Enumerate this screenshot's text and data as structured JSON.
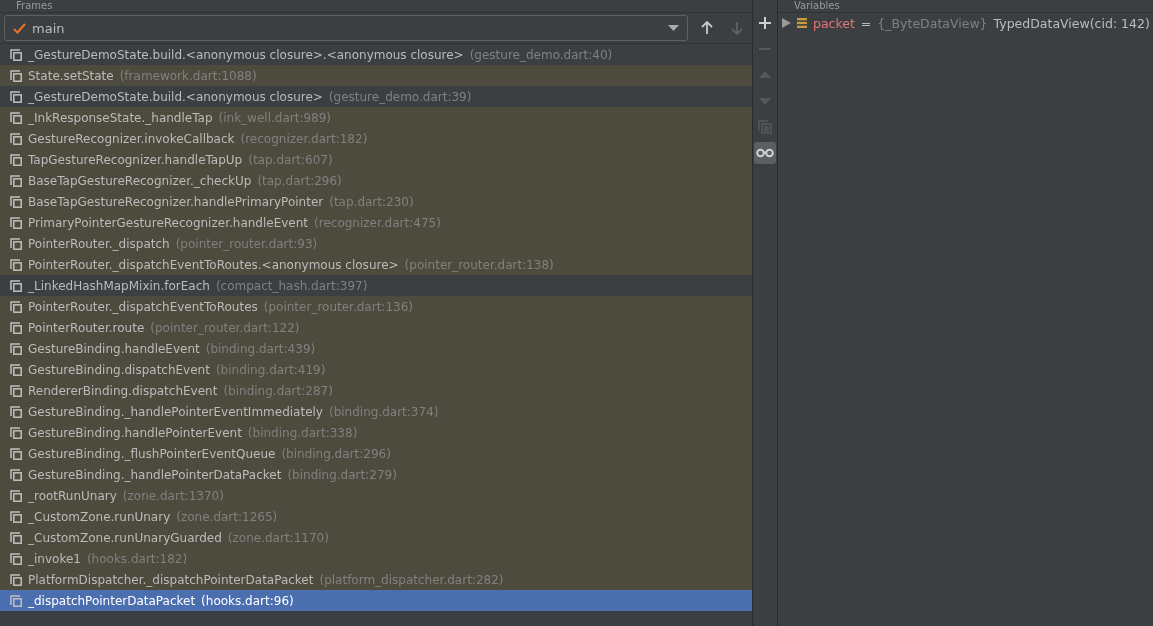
{
  "frames_panel": {
    "title": "Frames",
    "thread": {
      "value": "main"
    },
    "nav": [
      {
        "kind": "up",
        "disabled": false
      },
      {
        "kind": "down",
        "disabled": true
      }
    ],
    "rows": [
      {
        "method": "_GestureDemoState.build.<anonymous closure>.<anonymous closure>",
        "location": "(gesture_demo.dart:40)",
        "library": false,
        "selected": false
      },
      {
        "method": "State.setState",
        "location": "(framework.dart:1088)",
        "library": true,
        "selected": false
      },
      {
        "method": "_GestureDemoState.build.<anonymous closure>",
        "location": "(gesture_demo.dart:39)",
        "library": false,
        "selected": false
      },
      {
        "method": "_InkResponseState._handleTap",
        "location": "(ink_well.dart:989)",
        "library": true,
        "selected": false
      },
      {
        "method": "GestureRecognizer.invokeCallback",
        "location": "(recognizer.dart:182)",
        "library": true,
        "selected": false
      },
      {
        "method": "TapGestureRecognizer.handleTapUp",
        "location": "(tap.dart:607)",
        "library": true,
        "selected": false
      },
      {
        "method": "BaseTapGestureRecognizer._checkUp",
        "location": "(tap.dart:296)",
        "library": true,
        "selected": false
      },
      {
        "method": "BaseTapGestureRecognizer.handlePrimaryPointer",
        "location": "(tap.dart:230)",
        "library": true,
        "selected": false
      },
      {
        "method": "PrimaryPointerGestureRecognizer.handleEvent",
        "location": "(recognizer.dart:475)",
        "library": true,
        "selected": false
      },
      {
        "method": "PointerRouter._dispatch",
        "location": "(pointer_router.dart:93)",
        "library": true,
        "selected": false
      },
      {
        "method": "PointerRouter._dispatchEventToRoutes.<anonymous closure>",
        "location": "(pointer_router.dart:138)",
        "library": true,
        "selected": false
      },
      {
        "method": "_LinkedHashMapMixin.forEach",
        "location": "(compact_hash.dart:397)",
        "library": false,
        "selected": false
      },
      {
        "method": "PointerRouter._dispatchEventToRoutes",
        "location": "(pointer_router.dart:136)",
        "library": true,
        "selected": false
      },
      {
        "method": "PointerRouter.route",
        "location": "(pointer_router.dart:122)",
        "library": true,
        "selected": false
      },
      {
        "method": "GestureBinding.handleEvent",
        "location": "(binding.dart:439)",
        "library": true,
        "selected": false
      },
      {
        "method": "GestureBinding.dispatchEvent",
        "location": "(binding.dart:419)",
        "library": true,
        "selected": false
      },
      {
        "method": "RendererBinding.dispatchEvent",
        "location": "(binding.dart:287)",
        "library": true,
        "selected": false
      },
      {
        "method": "GestureBinding._handlePointerEventImmediately",
        "location": "(binding.dart:374)",
        "library": true,
        "selected": false
      },
      {
        "method": "GestureBinding.handlePointerEvent",
        "location": "(binding.dart:338)",
        "library": true,
        "selected": false
      },
      {
        "method": "GestureBinding._flushPointerEventQueue",
        "location": "(binding.dart:296)",
        "library": true,
        "selected": false
      },
      {
        "method": "GestureBinding._handlePointerDataPacket",
        "location": "(binding.dart:279)",
        "library": true,
        "selected": false
      },
      {
        "method": "_rootRunUnary",
        "location": "(zone.dart:1370)",
        "library": true,
        "selected": false
      },
      {
        "method": "_CustomZone.runUnary",
        "location": "(zone.dart:1265)",
        "library": true,
        "selected": false
      },
      {
        "method": "_CustomZone.runUnaryGuarded",
        "location": "(zone.dart:1170)",
        "library": true,
        "selected": false
      },
      {
        "method": "_invoke1",
        "location": "(hooks.dart:182)",
        "library": true,
        "selected": false
      },
      {
        "method": "PlatformDispatcher._dispatchPointerDataPacket",
        "location": "(platform_dispatcher.dart:282)",
        "library": true,
        "selected": false
      },
      {
        "method": "_dispatchPointerDataPacket",
        "location": "(hooks.dart:96)",
        "library": true,
        "selected": true
      }
    ]
  },
  "toolbar": [
    {
      "kind": "add",
      "disabled": false,
      "selected": false
    },
    {
      "kind": "remove",
      "disabled": true,
      "selected": false
    },
    {
      "kind": "up",
      "disabled": true,
      "selected": false
    },
    {
      "kind": "down",
      "disabled": true,
      "selected": false
    },
    {
      "kind": "copy",
      "disabled": true,
      "selected": false
    },
    {
      "kind": "watches",
      "disabled": false,
      "selected": true
    }
  ],
  "variables_panel": {
    "title": "Variables",
    "items": [
      {
        "name": "packet",
        "separator": "=",
        "type": "{_ByteDataView}",
        "value": "TypedDataView(cid: 142)",
        "expanded": false
      }
    ]
  }
}
